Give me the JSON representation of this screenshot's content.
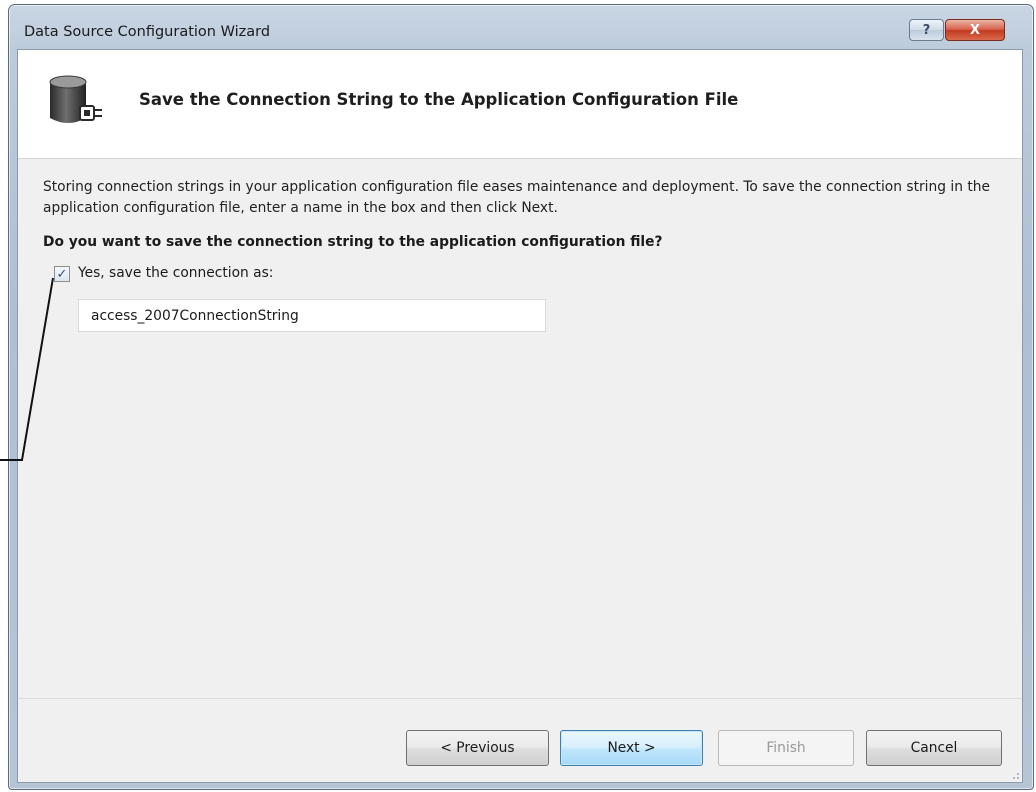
{
  "window": {
    "title": "Data Source Configuration Wizard",
    "help_glyph": "?",
    "close_glyph": "X"
  },
  "header": {
    "title": "Save the Connection String to the Application Configuration File",
    "icon": "database-plug-icon"
  },
  "body": {
    "description": "Storing connection strings in your application configuration file eases maintenance and deployment. To save the connection string in the application configuration file, enter a name in the box and then click Next.",
    "question": "Do you want to save the connection string to the application configuration file?",
    "save_checkbox": {
      "label": "Yes, save the connection as:",
      "checked": true,
      "mark": "✓"
    },
    "connection_name": {
      "value": "access_2007ConnectionString"
    }
  },
  "buttons": {
    "previous": "< Previous",
    "next": "Next >",
    "finish": "Finish",
    "cancel": "Cancel"
  },
  "colors": {
    "accent_button": "#bee6fd",
    "close_button": "#c2391f"
  }
}
